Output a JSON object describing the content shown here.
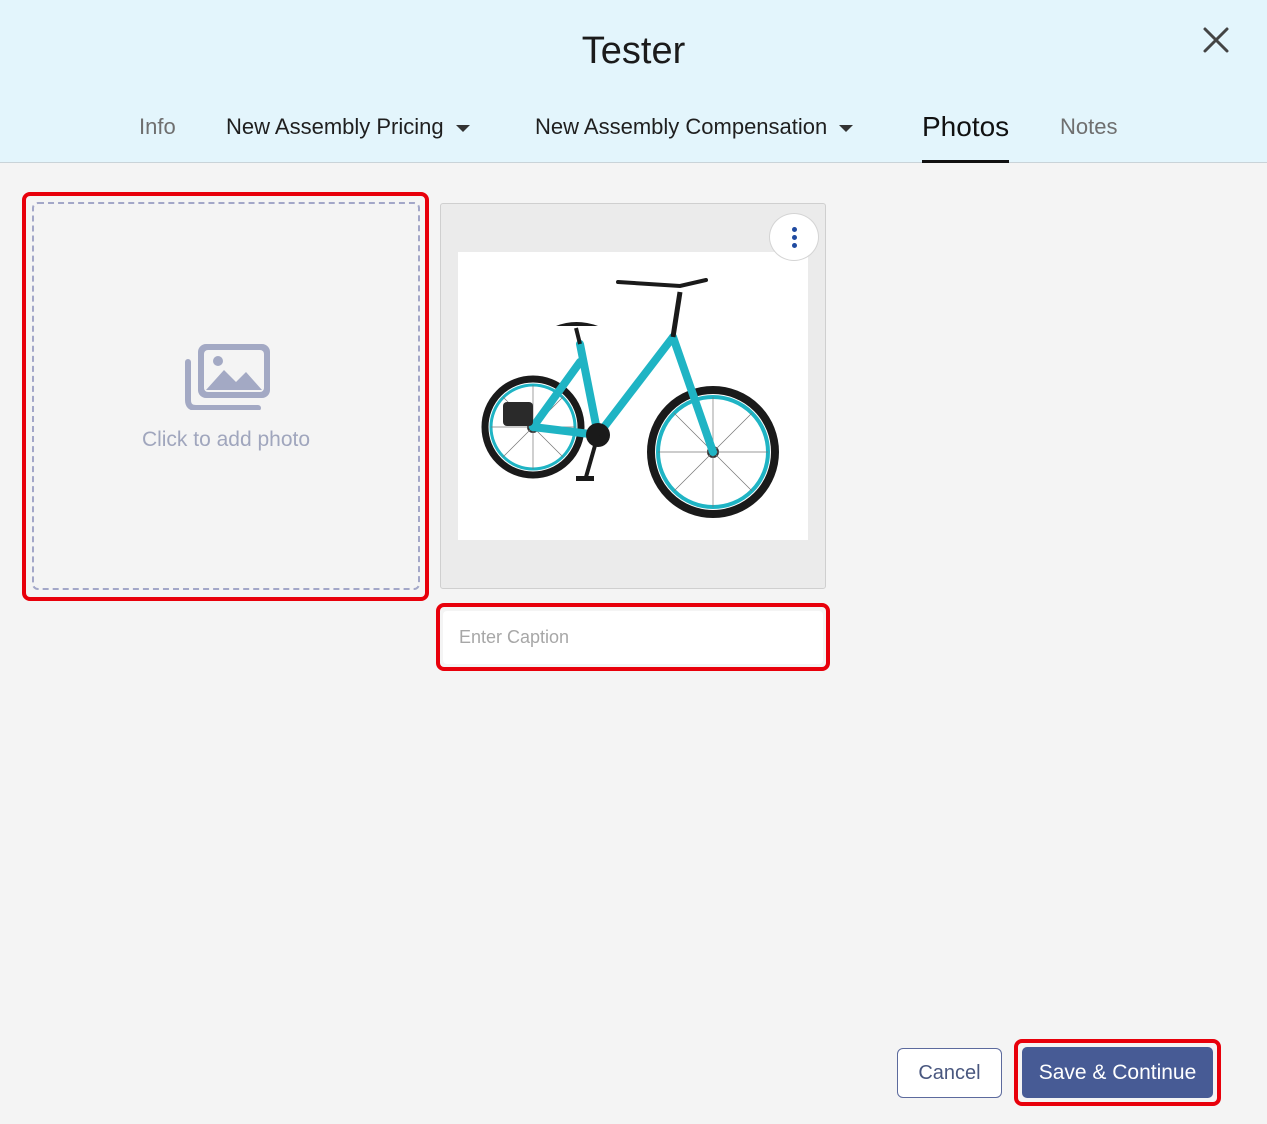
{
  "dialog": {
    "title": "Tester"
  },
  "tabs": [
    {
      "label": "Info",
      "active": false
    },
    {
      "label": "New Assembly Pricing",
      "active": false,
      "dropdown": true
    },
    {
      "label": "New Assembly Compensation",
      "active": false,
      "dropdown": true
    },
    {
      "label": "Photos",
      "active": true
    },
    {
      "label": "Notes",
      "active": false
    }
  ],
  "photos": {
    "add_label": "Click to add photo",
    "add_icon": "photo-gallery-icon",
    "items": [
      {
        "image": "teal step-through e-bike",
        "caption_placeholder": "Enter Caption",
        "caption_value": ""
      }
    ]
  },
  "footer": {
    "cancel_label": "Cancel",
    "save_label": "Save & Continue"
  },
  "colors": {
    "header_bg": "#e3f5fc",
    "primary": "#475b95",
    "highlight": "#e8000b",
    "accent_bike": "#1fb4c4"
  }
}
